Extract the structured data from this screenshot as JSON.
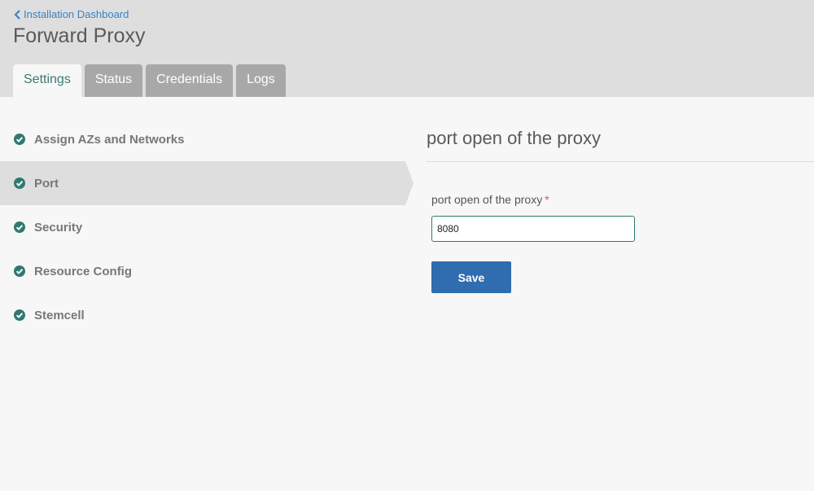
{
  "header": {
    "back_link": "Installation Dashboard",
    "title": "Forward Proxy",
    "tabs": [
      {
        "label": "Settings",
        "active": true
      },
      {
        "label": "Status",
        "active": false
      },
      {
        "label": "Credentials",
        "active": false
      },
      {
        "label": "Logs",
        "active": false
      }
    ]
  },
  "sidebar": {
    "items": [
      {
        "label": "Assign AZs and Networks",
        "icon": "check-circle-icon"
      },
      {
        "label": "Port",
        "icon": "check-circle-icon",
        "active": true
      },
      {
        "label": "Security",
        "icon": "check-circle-icon"
      },
      {
        "label": "Resource Config",
        "icon": "check-circle-icon"
      },
      {
        "label": "Stemcell",
        "icon": "check-circle-icon"
      }
    ]
  },
  "main": {
    "section_title": "port open of the proxy",
    "field_label": "port open of the proxy",
    "required_marker": "*",
    "port_value": "8080",
    "save_label": "Save"
  },
  "colors": {
    "accent_teal": "#2f7a70",
    "link_blue": "#3a82c4",
    "button_blue": "#2f6cb0",
    "required_red": "#d9534f"
  }
}
